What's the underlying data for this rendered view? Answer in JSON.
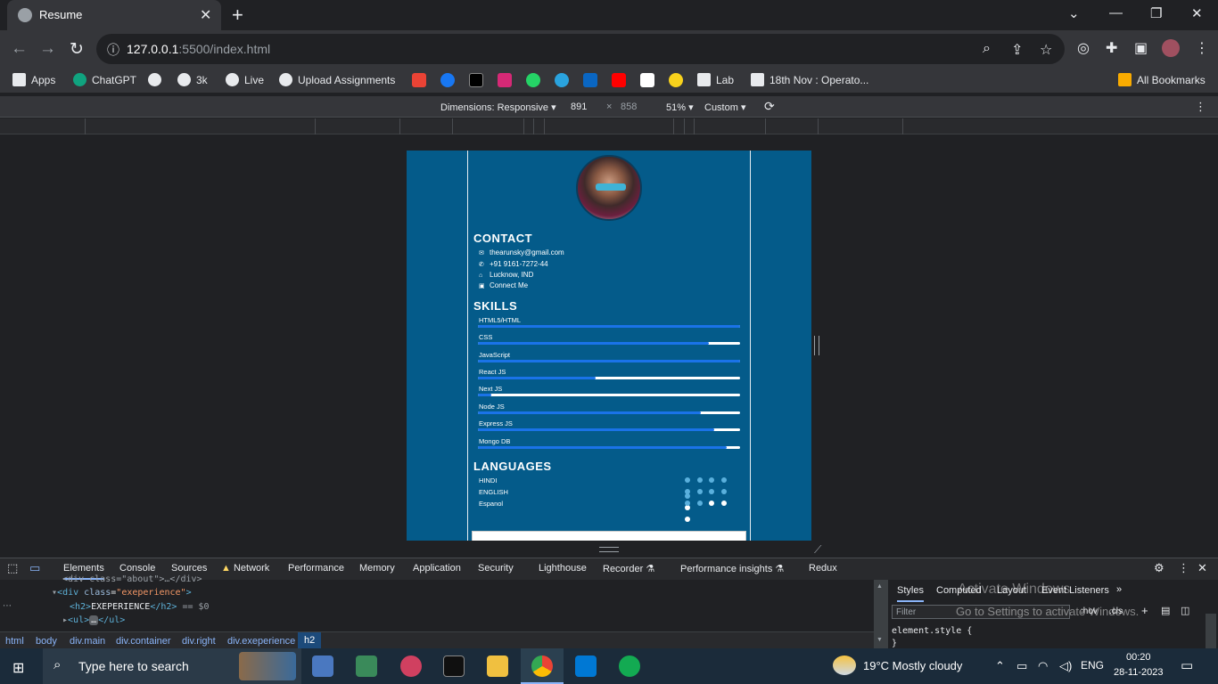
{
  "browser": {
    "tab_title": "Resume",
    "url_host": "127.0.0.1",
    "url_rest": ":5500/index.html"
  },
  "bookmarks": [
    {
      "label": "Apps",
      "color": "#e8eaed"
    },
    {
      "label": "ChatGPT",
      "color": "#10a37f"
    },
    {
      "label": "",
      "color": "#e8eaed"
    },
    {
      "label": "3k",
      "color": "#e8eaed"
    },
    {
      "label": "Live",
      "color": "#e8eaed"
    },
    {
      "label": "Upload Assignments",
      "color": "#e8eaed"
    }
  ],
  "bookmark_icons": [
    "gmail",
    "facebook",
    "x",
    "instagram",
    "whatsapp",
    "telegram",
    "linkedin",
    "youtube",
    "amazon",
    "flipkart"
  ],
  "bookmarks2": [
    {
      "label": "Lab"
    },
    {
      "label": "18th Nov : Operato..."
    }
  ],
  "all_bookmarks": "All Bookmarks",
  "devtoolbar": {
    "dimensions": "Dimensions: Responsive",
    "width": "891",
    "x": "×",
    "height": "858",
    "zoom": "51%",
    "throttle": "Custom"
  },
  "resume": {
    "contact_title": "CONTACT",
    "contact": [
      {
        "icon": "envelope-icon",
        "text": "thearunsky@gmail.com"
      },
      {
        "icon": "phone-icon",
        "text": "+91 9161-7272-44"
      },
      {
        "icon": "home-icon",
        "text": "Lucknow, IND"
      },
      {
        "icon": "linkedin-icon",
        "text": "Connect Me"
      }
    ],
    "skills_title": "SKILLS",
    "skills": [
      {
        "name": "HTML5/HTML",
        "level": 1.0
      },
      {
        "name": "CSS",
        "level": 0.88
      },
      {
        "name": "JavaScript",
        "level": 1.0
      },
      {
        "name": "React JS",
        "level": 0.45
      },
      {
        "name": "Next JS",
        "level": 0.05
      },
      {
        "name": "Node JS",
        "level": 0.85
      },
      {
        "name": "Express JS",
        "level": 0.9
      },
      {
        "name": "Mongo DB",
        "level": 0.95
      }
    ],
    "languages_title": "LANGUAGES",
    "languages": [
      {
        "name": "HINDI",
        "filled": 5
      },
      {
        "name": "ENGLISH",
        "filled": 4
      },
      {
        "name": "Espanol",
        "filled": 2
      }
    ]
  },
  "devtools": {
    "tabs": [
      "Elements",
      "Console",
      "Sources",
      "Network",
      "Performance",
      "Memory",
      "Application",
      "Security",
      "Lighthouse",
      "Recorder",
      "Performance insights",
      "Redux"
    ],
    "code_line0": "div class=\"about\">…</div>",
    "code_line1_tag": "div",
    "code_line1_attr": "class",
    "code_line1_val": "\"exeperience\"",
    "code_line2_text": "EXEPERIENCE",
    "code_line2_eq": "== $0",
    "code_line3": "ul",
    "breadcrumbs": [
      "html",
      "body",
      "div.main",
      "div.container",
      "div.right",
      "div.exeperience",
      "h2"
    ],
    "styles_tabs": [
      "Styles",
      "Computed",
      "Layout",
      "Event Listeners"
    ],
    "filter_placeholder": "Filter",
    "hov": ":hov",
    "cls": ".cls",
    "element_style": "element.style {",
    "close_brace": "}",
    "watermark1": "Activate Windows",
    "watermark2": "Go to Settings to activate Windows."
  },
  "taskbar": {
    "search": "Type here to search",
    "weather": "19°C  Mostly cloudy",
    "lang": "ENG",
    "time": "00:20",
    "date": "28-11-2023"
  }
}
